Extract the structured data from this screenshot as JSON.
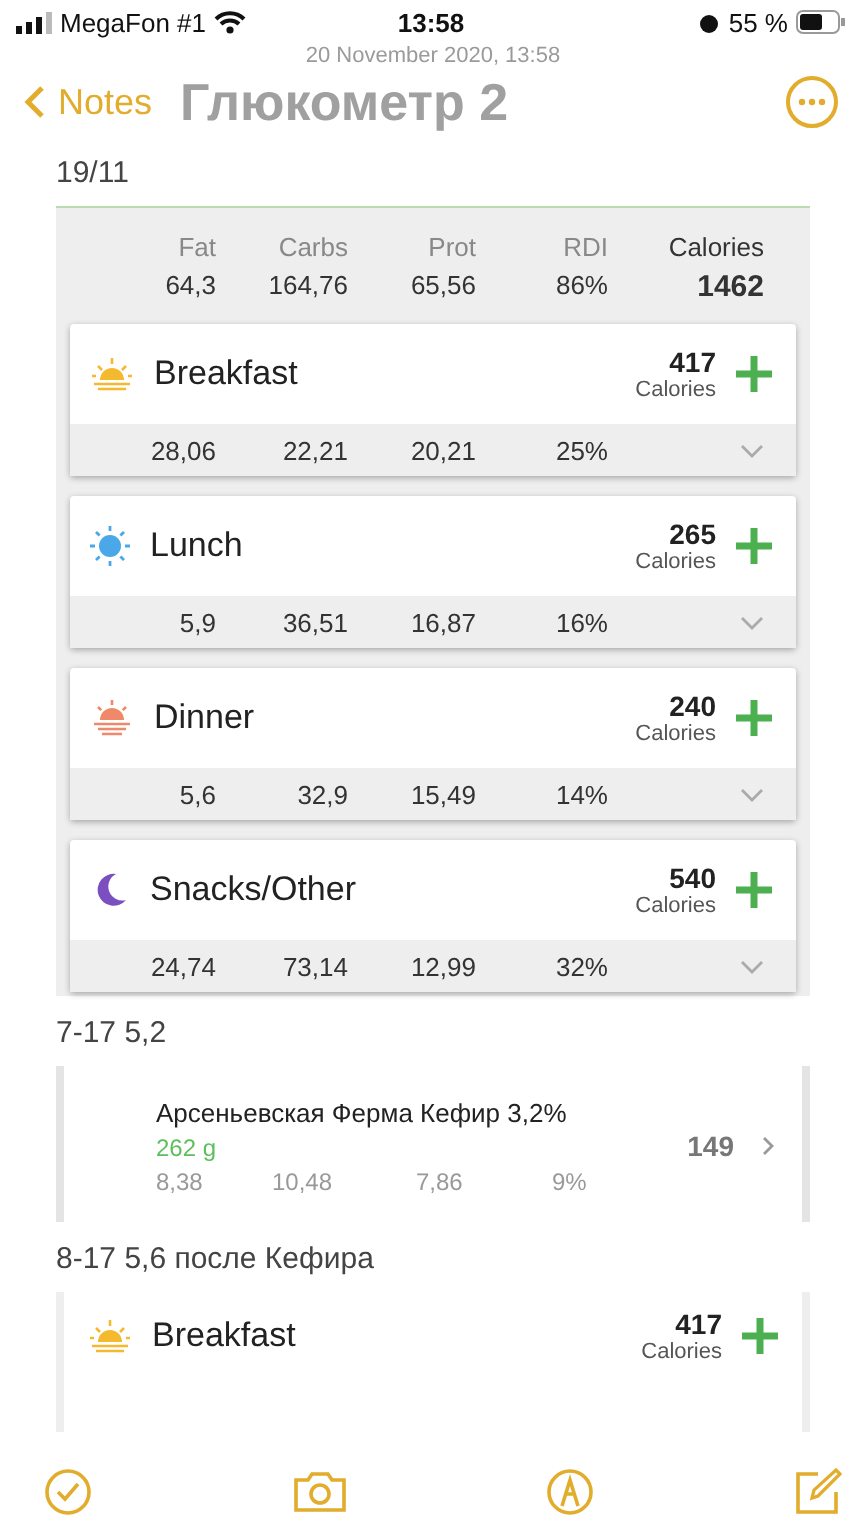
{
  "status_bar": {
    "carrier": "MegaFon #1",
    "time": "13:58",
    "battery": "55 %"
  },
  "note_date": "20 November 2020, 13:58",
  "nav": {
    "back": "Notes",
    "title": "Глюкометр 2"
  },
  "date_line": "19/11",
  "summary": {
    "columns": [
      "Fat",
      "Carbs",
      "Prot",
      "RDI",
      "Calories"
    ],
    "values": [
      "64,3",
      "164,76",
      "65,56",
      "86%",
      "1462"
    ]
  },
  "meals": [
    {
      "kind": "sunrise",
      "name": "Breakfast",
      "calories": "417",
      "calories_label": "Calories",
      "values": [
        "28,06",
        "22,21",
        "20,21",
        "25%"
      ]
    },
    {
      "kind": "sun",
      "name": "Lunch",
      "calories": "265",
      "calories_label": "Calories",
      "values": [
        "5,9",
        "36,51",
        "16,87",
        "16%"
      ]
    },
    {
      "kind": "sunset",
      "name": "Dinner",
      "calories": "240",
      "calories_label": "Calories",
      "values": [
        "5,6",
        "32,9",
        "15,49",
        "14%"
      ]
    },
    {
      "kind": "moon",
      "name": "Snacks/Other",
      "calories": "540",
      "calories_label": "Calories",
      "values": [
        "24,74",
        "73,14",
        "12,99",
        "32%"
      ]
    }
  ],
  "note_line_1": "7-17 5,2",
  "food": {
    "name": "Арсеньевская Ферма Кефир 3,2%",
    "amount": "262 g",
    "calories": "149",
    "values": [
      "8,38",
      "10,48",
      "7,86",
      "9%"
    ]
  },
  "note_line_2": "8-17 5,6 после Кефира",
  "peek_meal": {
    "kind": "sunrise",
    "name": "Breakfast",
    "calories": "417",
    "calories_label": "Calories"
  }
}
